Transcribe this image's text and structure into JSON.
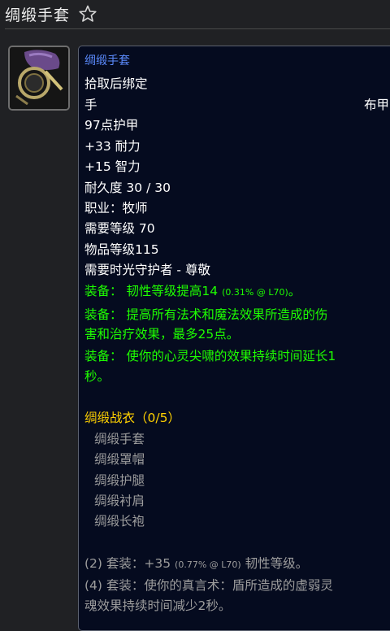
{
  "header": {
    "title": "绸缎手套",
    "favorite_icon": "star-outline-icon"
  },
  "item": {
    "name": "绸缎手套",
    "bind": "拾取后绑定",
    "slot": "手",
    "armor_type": "布甲",
    "armor": "97点护甲",
    "stamina": "+33 耐力",
    "intellect": "+15 智力",
    "durability": "耐久度 30 / 30",
    "class": "职业：牧师",
    "required_level": "需要等级 70",
    "item_level": "物品等级115",
    "reputation": "需要时光守护者 - 尊敬",
    "equip1_main": "装备： 韧性等级提高14",
    "equip1_note": "(0.31% @ L70)",
    "equip1_end": "。",
    "equip2_line1": "装备： 提高所有法术和魔法效果所造成的伤",
    "equip2_line2": "害和治疗效果，最多25点。",
    "equip3_line1": "装备： 使你的心灵尖啸的效果持续时间延长1",
    "equip3_line2": "秒。"
  },
  "set": {
    "title": "绸缎战衣（0/5）",
    "pieces": [
      "绸缎手套",
      "绸缎罩帽",
      "绸缎护腿",
      "绸缎衬肩",
      "绸缎长袍"
    ],
    "bonus2_main": "(2) 套装：+35",
    "bonus2_note": "(0.77% @ L70)",
    "bonus2_end": "韧性等级。",
    "bonus4_line1": "(4) 套装：使你的真言术：盾所造成的虚弱灵",
    "bonus4_line2": "魂效果持续时间减少2秒。"
  }
}
